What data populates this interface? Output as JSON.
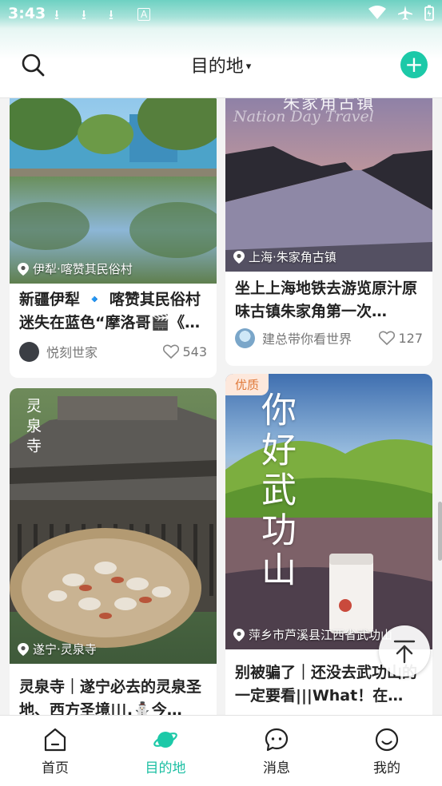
{
  "status_bar": {
    "time": "3:43",
    "download_icons": [
      "⭳",
      "⭳",
      "⭳"
    ],
    "a_icon": "A"
  },
  "header": {
    "title": "目的地",
    "caret": "▾",
    "add_label": "+"
  },
  "cards": [
    {
      "location": "伊犁·喀赞其民俗村",
      "title": "新疆伊犁 🔹 喀赞其民俗村 迷失在蓝色“摩洛哥🎬《…",
      "author": "悦刻世家",
      "likes": "543"
    },
    {
      "location": "上海·朱家角古镇",
      "title": "坐上上海地铁去游览原汁原味古镇朱家角第一次…",
      "author": "建总带你看世界",
      "likes": "127",
      "overlay_text": "朱家角古镇",
      "overlay_script": "Nation Day Travel"
    },
    {
      "location": "遂宁·灵泉寺",
      "title": "灵泉寺｜遂宁必去的灵泉圣地、西方圣境|||.⛄今…",
      "overlay_text": "灵泉寺"
    },
    {
      "badge": "优质",
      "location": "萍乡市芦溪县江西省武功山",
      "title": "别被骗了｜还没去武功山的一定要看|||What！在…",
      "overlay_text": "你好武功山"
    }
  ],
  "tabs": [
    {
      "label": "首页",
      "active": false
    },
    {
      "label": "目的地",
      "active": true
    },
    {
      "label": "消息",
      "active": false
    },
    {
      "label": "我的",
      "active": false
    }
  ],
  "colors": {
    "accent": "#1cc9a8",
    "badge_bg": "#fde8dc",
    "badge_text": "#e07a3a"
  }
}
